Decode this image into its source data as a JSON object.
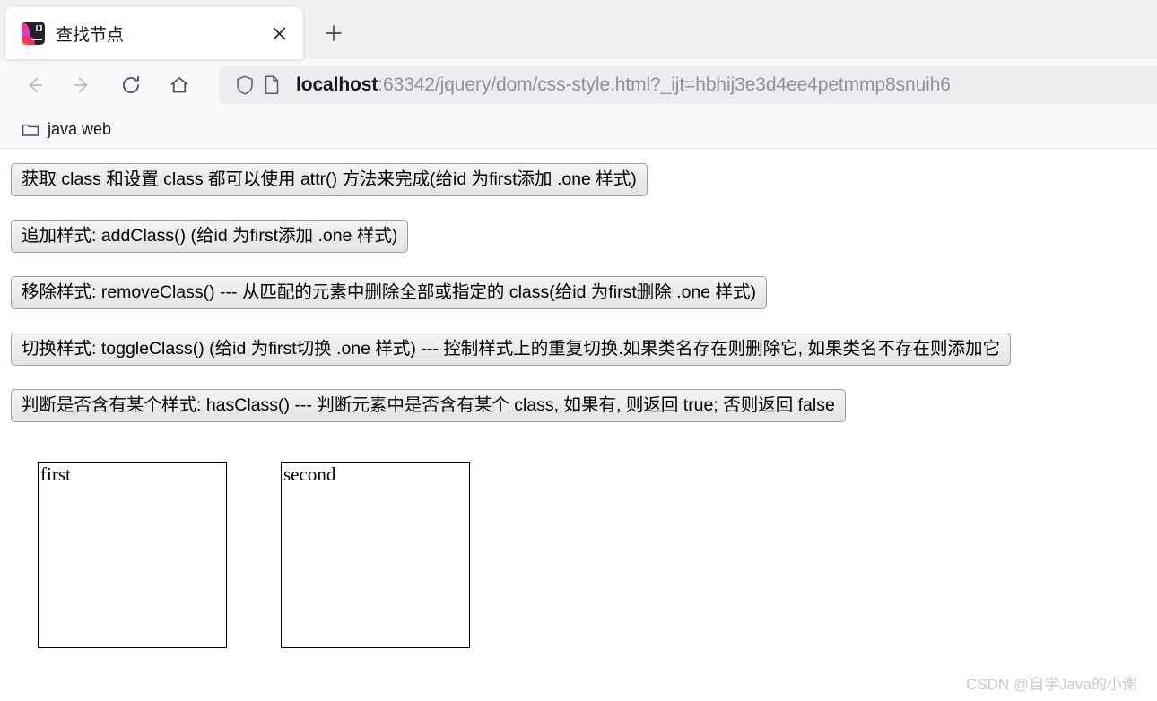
{
  "browser": {
    "tab": {
      "title": "查找节点",
      "favicon_name": "intellij-idea-icon",
      "favicon_letters": "IJ",
      "close_label": "×"
    },
    "new_tab_label": "+",
    "nav": {
      "back_label": "←",
      "forward_label": "→",
      "reload_label": "⟳",
      "home_label": "⌂"
    },
    "urlbar": {
      "host": "localhost",
      "path": ":63342/jquery/dom/css-style.html?_ijt=hbhij3e3d4ee4petmmp8snuih6",
      "full_url": "localhost:63342/jquery/dom/css-style.html?_ijt=hbhij3e3d4ee4petmmp8snuih6",
      "shield_icon": "shield-icon",
      "page_icon": "page-icon"
    },
    "bookmarks": [
      {
        "label": "java web",
        "icon": "folder-icon"
      }
    ]
  },
  "page": {
    "buttons": [
      "获取 class 和设置 class 都可以使用 attr() 方法来完成(给id 为first添加 .one 样式)",
      "追加样式: addClass() (给id 为first添加 .one 样式)",
      "移除样式: removeClass() --- 从匹配的元素中删除全部或指定的 class(给id 为first删除 .one 样式)",
      "切换样式: toggleClass() (给id 为first切换 .one 样式) --- 控制样式上的重复切换.如果类名存在则删除它, 如果类名不存在则添加它",
      "判断是否含有某个样式: hasClass() --- 判断元素中是否含有某个 class, 如果有, 则返回 true; 否则返回 false"
    ],
    "boxes": [
      {
        "label": "first"
      },
      {
        "label": "second"
      }
    ],
    "watermark": "CSDN @自学Java的小谢"
  },
  "colors": {
    "tabstrip_bg": "#f0f0f0",
    "toolbar_bg": "#f9f9fb",
    "urlbar_bg": "#ededf0",
    "text_dark": "#15141a",
    "text_muted": "#8f8f9d",
    "button_border": "#9d9d9d",
    "watermark": "#c8c8c8"
  }
}
